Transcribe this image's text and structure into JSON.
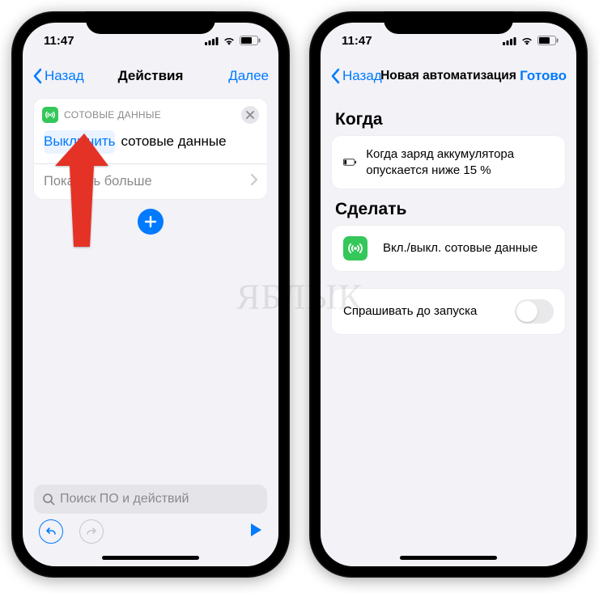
{
  "status": {
    "time": "11:47"
  },
  "left": {
    "nav": {
      "back": "Назад",
      "title": "Действия",
      "next": "Далее"
    },
    "action": {
      "app_label": "СОТОВЫЕ ДАННЫЕ",
      "token": "Выключить",
      "rest": "сотовые данные",
      "show_more": "Показать больше"
    },
    "search_placeholder": "Поиск ПО и действий"
  },
  "right": {
    "nav": {
      "back": "Назад",
      "title": "Новая автоматизация",
      "done": "Готово"
    },
    "when_header": "Когда",
    "when_text": "Когда заряд аккумулятора опускается ниже 15 %",
    "do_header": "Сделать",
    "do_text": "Вкл./выкл. сотовые данные",
    "ask_before": "Спрашивать до запуска"
  },
  "watermark": "ЯБЛЫК"
}
